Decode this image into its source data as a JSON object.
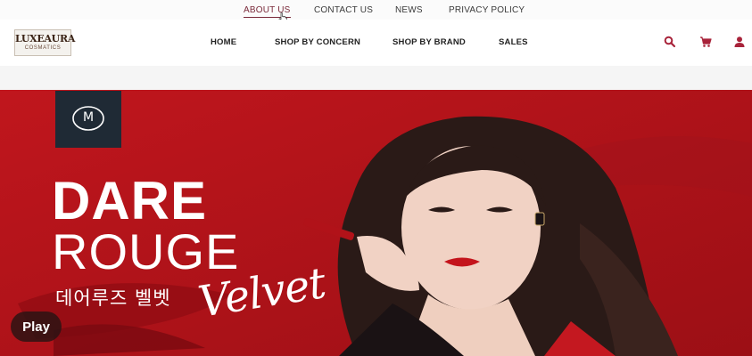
{
  "top_links": [
    {
      "label": "ABOUT US",
      "active": true
    },
    {
      "label": "CONTACT US",
      "active": false
    },
    {
      "label": "NEWS",
      "active": false
    },
    {
      "label": "PRIVACY POLICY",
      "active": false
    }
  ],
  "logo": {
    "brand": "LUXEAURA",
    "sub": "COSMATICS"
  },
  "nav": [
    "HOME",
    "SHOP BY CONCERN",
    "SHOP BY BRAND",
    "SALES"
  ],
  "header_icons": [
    "search-icon",
    "cart-icon",
    "user-icon"
  ],
  "hero": {
    "badge_letter": "M",
    "title_line1": "DARE",
    "title_line2": "ROUGE",
    "korean": "데어루즈 벨벳",
    "script": "Velvet",
    "bg_color": "#b5131a"
  },
  "player": {
    "play_label": "Play"
  },
  "colors": {
    "accent": "#a8233a",
    "hero_red": "#b5131a",
    "badge": "#1f2a35"
  }
}
